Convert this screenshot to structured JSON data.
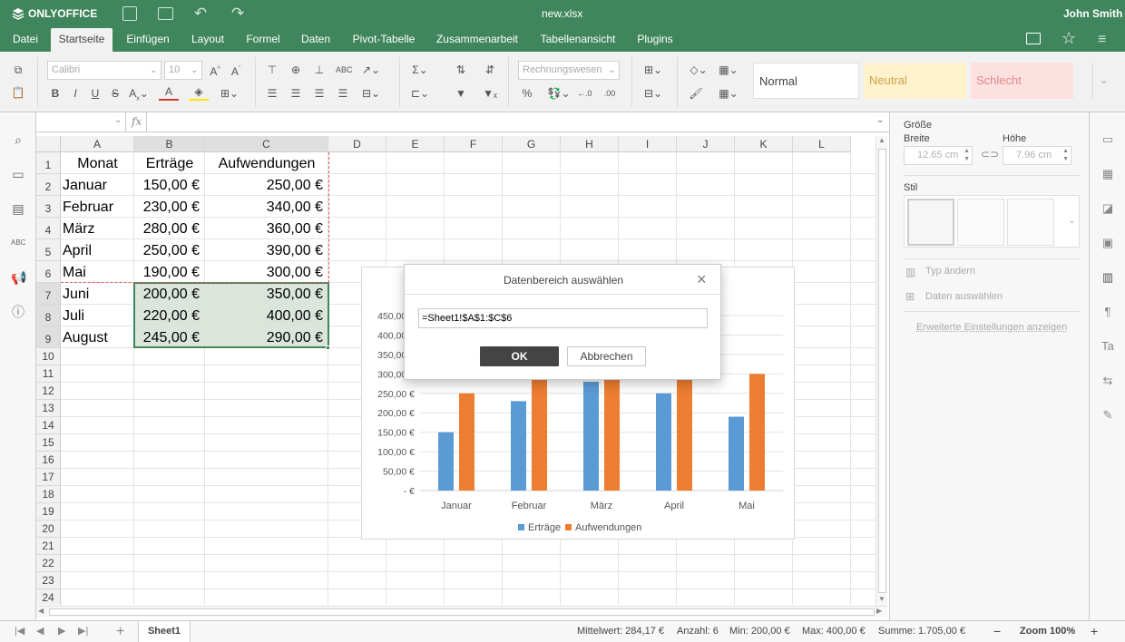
{
  "app": {
    "brand": "ONLYOFFICE",
    "doc_title": "new.xlsx",
    "user": "John Smith"
  },
  "menu": {
    "tabs": [
      "Datei",
      "Startseite",
      "Einfügen",
      "Layout",
      "Formel",
      "Daten",
      "Pivot-Tabelle",
      "Zusammenarbeit",
      "Tabellenansicht",
      "Plugins"
    ],
    "active": "Startseite"
  },
  "toolbar": {
    "font_name": "Calibri",
    "font_size": "10",
    "number_format": "Rechnungswesen",
    "styles": {
      "normal": "Normal",
      "neutral": "Neutral",
      "bad": "Schlecht"
    }
  },
  "formula_bar": {
    "cell_ref": "",
    "fx": "fx",
    "value": ""
  },
  "sheet": {
    "columns": [
      "A",
      "B",
      "C",
      "D",
      "E",
      "F",
      "G",
      "H",
      "I",
      "J",
      "K",
      "L"
    ],
    "rows": [
      "1",
      "2",
      "3",
      "4",
      "5",
      "6",
      "7",
      "8",
      "9",
      "10",
      "11",
      "12",
      "13",
      "14",
      "15",
      "16",
      "17",
      "18",
      "19",
      "20",
      "21",
      "22",
      "23",
      "24"
    ],
    "data": [
      [
        "Monat",
        "Erträge",
        "Aufwendungen"
      ],
      [
        "Januar",
        "150,00 €",
        "250,00 €"
      ],
      [
        "Februar",
        "230,00 €",
        "340,00 €"
      ],
      [
        "März",
        "280,00 €",
        "360,00 €"
      ],
      [
        "April",
        "250,00 €",
        "390,00 €"
      ],
      [
        "Mai",
        "190,00 €",
        "300,00 €"
      ],
      [
        "Juni",
        "200,00 €",
        "350,00 €"
      ],
      [
        "Juli",
        "220,00 €",
        "400,00 €"
      ],
      [
        "August",
        "245,00 €",
        "290,00 €"
      ]
    ]
  },
  "chart_data": {
    "type": "bar",
    "categories": [
      "Januar",
      "Februar",
      "März",
      "April",
      "Mai"
    ],
    "series": [
      {
        "name": "Erträge",
        "values": [
          150,
          230,
          280,
          250,
          190
        ],
        "color": "#5b9bd5"
      },
      {
        "name": "Aufwendungen",
        "values": [
          250,
          340,
          360,
          390,
          300
        ],
        "color": "#ed7d31"
      }
    ],
    "ytick_labels": [
      "-   €",
      "50,00 €",
      "100,00 €",
      "150,00 €",
      "200,00 €",
      "250,00 €",
      "300,00 €",
      "350,00 €",
      "400,00 €",
      "450,00 €"
    ],
    "ylim": [
      0,
      450
    ],
    "legend": "bottom",
    "grid": true
  },
  "dialog": {
    "title": "Datenbereich auswählen",
    "range": "=Sheet1!$A$1:$C$6",
    "ok": "OK",
    "cancel": "Abbrechen"
  },
  "right_panel": {
    "size_label": "Größe",
    "width_label": "Breite",
    "height_label": "Höhe",
    "width": "12.65 cm",
    "height": "7.96 cm",
    "style_label": "Stil",
    "change_type": "Typ ändern",
    "select_data": "Daten auswählen",
    "advanced": "Erweiterte Einstellungen anzeigen"
  },
  "status": {
    "sheet_tab": "Sheet1",
    "average": "Mittelwert: 284,17 €",
    "count": "Anzahl: 6",
    "min": "Min: 200,00 €",
    "max": "Max: 400,00 €",
    "sum": "Summe: 1.705,00 €",
    "zoom": "Zoom 100%"
  },
  "colors": {
    "brand_green": "#40865c",
    "selection": "#dbe5dc"
  }
}
